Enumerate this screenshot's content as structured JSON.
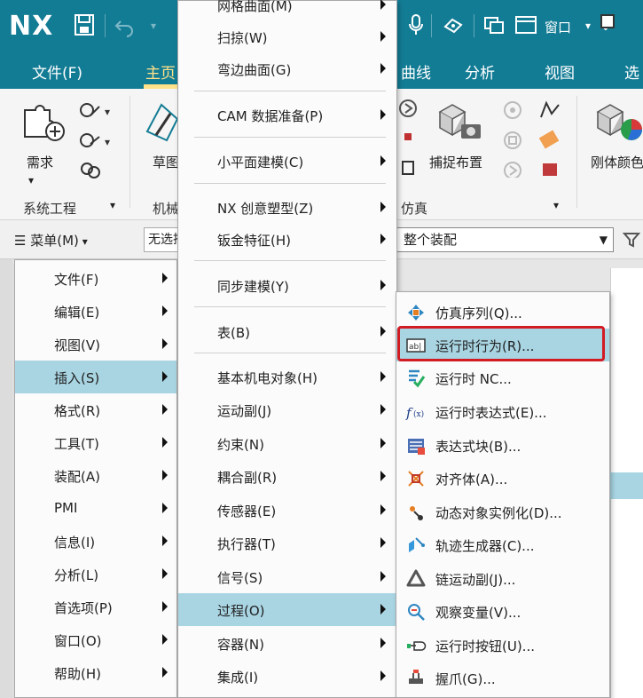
{
  "app": {
    "logo": "NX",
    "window_menu": "窗口"
  },
  "ribbon_tabs": [
    {
      "label": "文件(F)"
    },
    {
      "label": "主页"
    },
    {
      "label": "曲线"
    },
    {
      "label": "分析"
    },
    {
      "label": "视图"
    },
    {
      "label": "选"
    }
  ],
  "ribbon": {
    "buttons": {
      "requirements": "需求",
      "sketch": "草图",
      "capture_layout": "捕捉布置",
      "rigid_color": "刚体颜色"
    },
    "groups": {
      "systems_engineering": "系统工程",
      "mechanical": "机械",
      "simulation": "仿真"
    }
  },
  "selection_bar": {
    "menu_button": "菜单(M)",
    "filter_value": "无选择过滤器",
    "scope_value": "整个装配"
  },
  "main_menu": [
    {
      "label": "文件(F)",
      "submenu": true
    },
    {
      "label": "编辑(E)",
      "submenu": true
    },
    {
      "label": "视图(V)",
      "submenu": true
    },
    {
      "label": "插入(S)",
      "submenu": true,
      "highlighted": true
    },
    {
      "label": "格式(R)",
      "submenu": true
    },
    {
      "label": "工具(T)",
      "submenu": true
    },
    {
      "label": "装配(A)",
      "submenu": true
    },
    {
      "label": "PMI",
      "submenu": true
    },
    {
      "label": "信息(I)",
      "submenu": true
    },
    {
      "label": "分析(L)",
      "submenu": true
    },
    {
      "label": "首选项(P)",
      "submenu": true
    },
    {
      "label": "窗口(O)",
      "submenu": true
    },
    {
      "label": "帮助(H)",
      "submenu": true
    }
  ],
  "insert_menu": [
    {
      "label": "网格曲面(M)",
      "submenu": true
    },
    {
      "label": "扫掠(W)",
      "submenu": true
    },
    {
      "label": "弯边曲面(G)",
      "submenu": true
    },
    {
      "label": "CAM 数据准备(P)",
      "submenu": true
    },
    {
      "label": "小平面建模(C)",
      "submenu": true
    },
    {
      "label": "NX 创意塑型(Z)",
      "submenu": true
    },
    {
      "label": "钣金特征(H)",
      "submenu": true
    },
    {
      "label": "同步建模(Y)",
      "submenu": true
    },
    {
      "label": "表(B)",
      "submenu": true
    },
    {
      "label": "基本机电对象(H)",
      "submenu": true
    },
    {
      "label": "运动副(J)",
      "submenu": true
    },
    {
      "label": "约束(N)",
      "submenu": true
    },
    {
      "label": "耦合副(R)",
      "submenu": true
    },
    {
      "label": "传感器(E)",
      "submenu": true
    },
    {
      "label": "执行器(T)",
      "submenu": true
    },
    {
      "label": "信号(S)",
      "submenu": true
    },
    {
      "label": "过程(O)",
      "submenu": true,
      "highlighted": true
    },
    {
      "label": "容器(N)",
      "submenu": true
    },
    {
      "label": "集成(I)",
      "submenu": true
    }
  ],
  "process_menu": [
    {
      "label": "仿真序列(Q)...",
      "icon": "simulation-sequence-icon"
    },
    {
      "label": "运行时行为(R)...",
      "icon": "runtime-behavior-icon",
      "highlighted": true
    },
    {
      "label": "运行时 NC...",
      "icon": "runtime-nc-icon"
    },
    {
      "label": "运行时表达式(E)...",
      "icon": "runtime-expression-icon"
    },
    {
      "label": "表达式块(B)...",
      "icon": "expression-block-icon"
    },
    {
      "label": "对齐体(A)...",
      "icon": "align-body-icon"
    },
    {
      "label": "动态对象实例化(D)...",
      "icon": "dynamic-object-icon"
    },
    {
      "label": "轨迹生成器(C)...",
      "icon": "trajectory-generator-icon"
    },
    {
      "label": "链运动副(J)...",
      "icon": "chain-joint-icon"
    },
    {
      "label": "观察变量(V)...",
      "icon": "watch-variable-icon"
    },
    {
      "label": "运行时按钮(U)...",
      "icon": "runtime-button-icon"
    },
    {
      "label": "握爪(G)...",
      "icon": "gripper-icon"
    }
  ],
  "colors": {
    "brand": "#137c95",
    "highlight": "#a9d5e3",
    "annotation_box": "#d21c24"
  }
}
